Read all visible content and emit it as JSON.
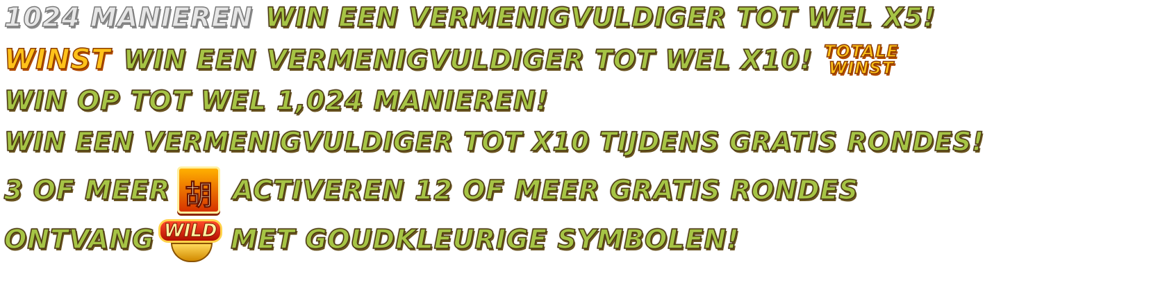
{
  "lines": [
    {
      "id": 1,
      "prefix": "1024 MANIEREN",
      "text": "WIN EEN VERMENIGVULDIGER TOT WEL X5!"
    },
    {
      "id": 2,
      "prefix": "WINST",
      "text": "WIN EEN VERMENIGVULDIGER TOT WEL X10!",
      "suffix_top": "TOTALE",
      "suffix_bottom": "WINST"
    },
    {
      "id": 3,
      "text": "WIN OP TOT WEL 1,024 MANIEREN!"
    },
    {
      "id": 4,
      "text": "WIN EEN VERMENIGVULDIGER TOT X10 TIJDENS GRATIS RONDES!"
    },
    {
      "id": 5,
      "before": "3 OF MEER",
      "symbol_glyph": "胡",
      "after": "ACTIVEREN 12 OF MEER GRATIS RONDES"
    },
    {
      "id": 6,
      "before": "ONTVANG",
      "wild_label": "WILD",
      "after": "MET GOUDKLEURIGE SYMBOLEN!"
    }
  ],
  "icons": {
    "scatter": "scatter-symbol-icon",
    "wild": "wild-symbol-icon"
  },
  "colors": {
    "green_text": "#a6c445",
    "silver_text": "#e6e6e6",
    "gold_text": "#ffc21a",
    "outline": "#4a3712"
  }
}
